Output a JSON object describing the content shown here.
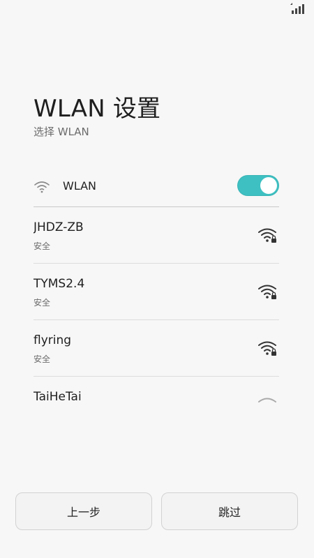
{
  "header": {
    "title": "WLAN 设置",
    "subtitle": "选择 WLAN"
  },
  "wlan_toggle": {
    "label": "WLAN",
    "enabled": true,
    "accent_color": "#3ec0c2"
  },
  "networks": [
    {
      "name": "JHDZ-ZB",
      "security": "安全",
      "icon": "wifi-lock-icon"
    },
    {
      "name": "TYMS2.4",
      "security": "安全",
      "icon": "wifi-lock-icon"
    },
    {
      "name": "flyring",
      "security": "安全",
      "icon": "wifi-lock-icon"
    },
    {
      "name": "TaiHeTai",
      "security": "",
      "icon": "wifi-icon"
    }
  ],
  "footer": {
    "prev_label": "上一步",
    "skip_label": "跳过"
  }
}
